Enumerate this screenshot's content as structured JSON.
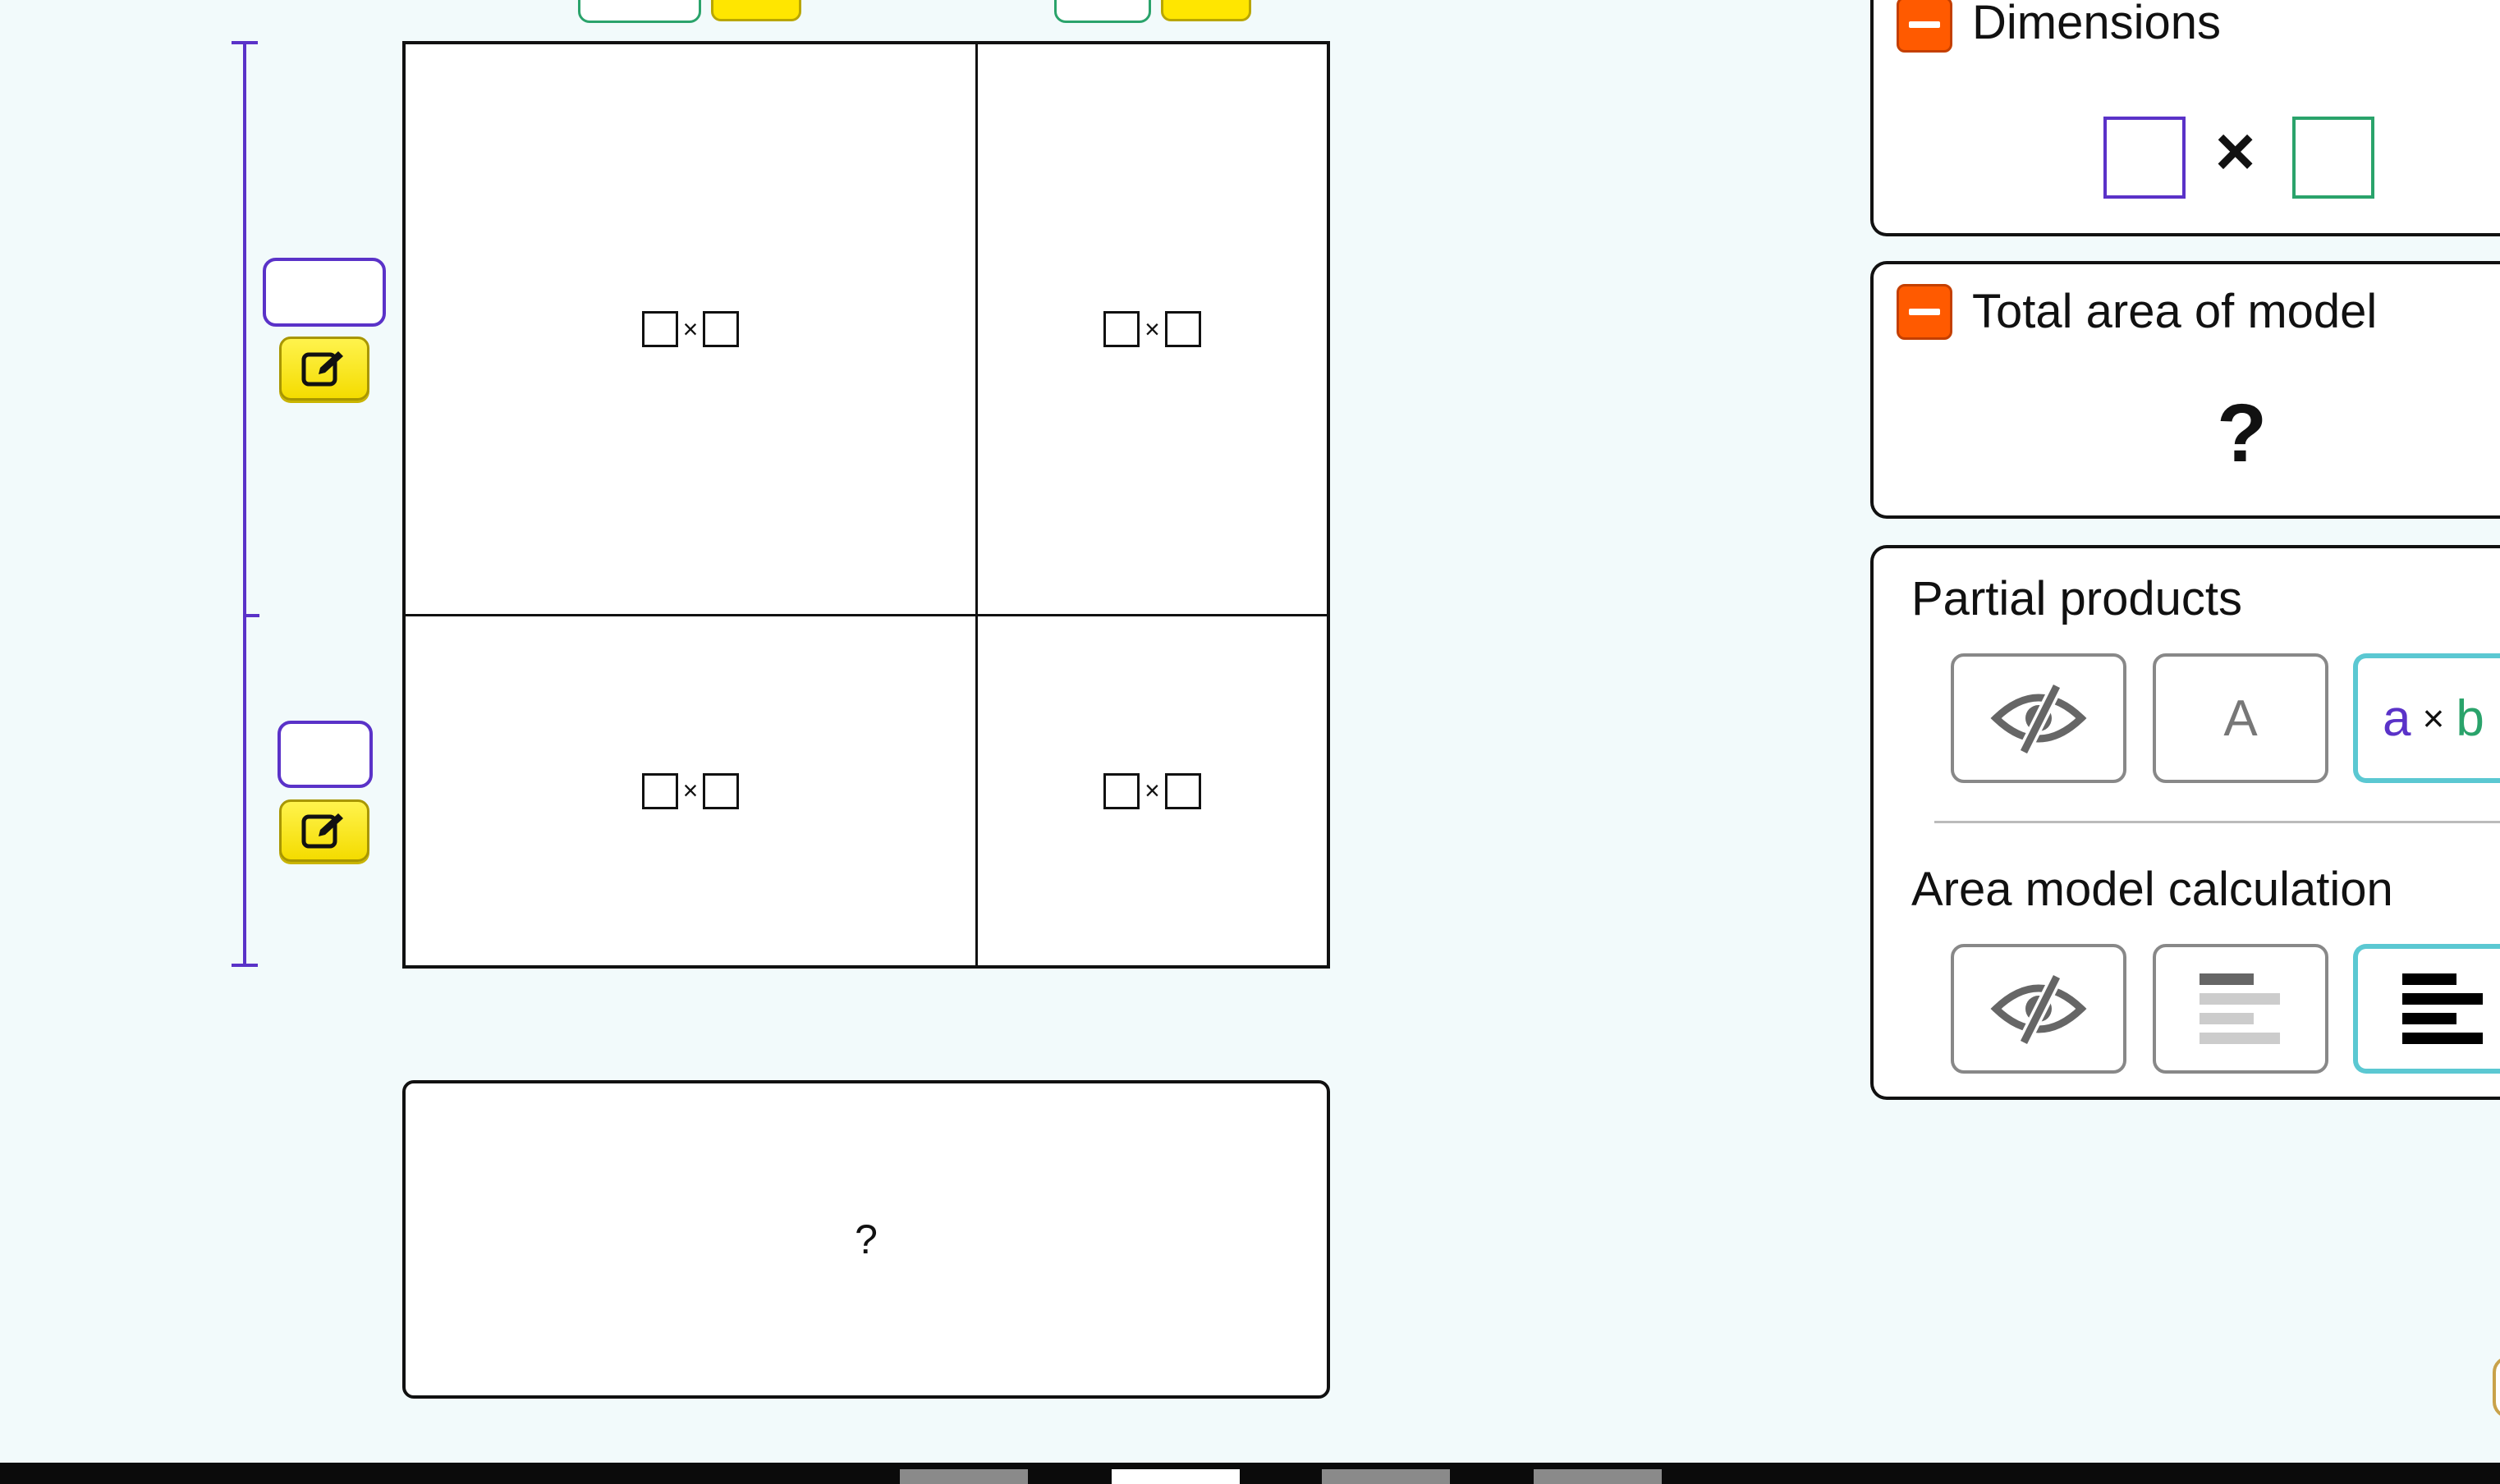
{
  "area_model": {
    "cells": [
      {
        "times": "×"
      },
      {
        "times": "×"
      },
      {
        "times": "×"
      },
      {
        "times": "×"
      }
    ],
    "total_placeholder": "?"
  },
  "panel": {
    "dimensions": {
      "title": "Dimensions",
      "times": "×"
    },
    "total_area": {
      "title": "Total area of model",
      "value": "?"
    },
    "partial_products": {
      "title": "Partial products",
      "options": [
        {
          "icon": "eye-slash-icon"
        },
        {
          "label": "A"
        },
        {
          "label_a": "a",
          "times": "×",
          "label_b": "b"
        }
      ]
    },
    "calculation": {
      "title": "Area model calculation",
      "options": [
        {
          "icon": "eye-slash-icon"
        },
        {
          "icon": "faded-lines-icon"
        },
        {
          "icon": "bold-lines-icon"
        }
      ]
    }
  },
  "colors": {
    "accent_purple": "#5a32c8",
    "accent_green": "#2aa36b",
    "edit_yellow": "#ffe600",
    "collapse_orange": "#ff5a00",
    "selected_cyan": "#5bc8d2",
    "background": "#f2fafb"
  }
}
